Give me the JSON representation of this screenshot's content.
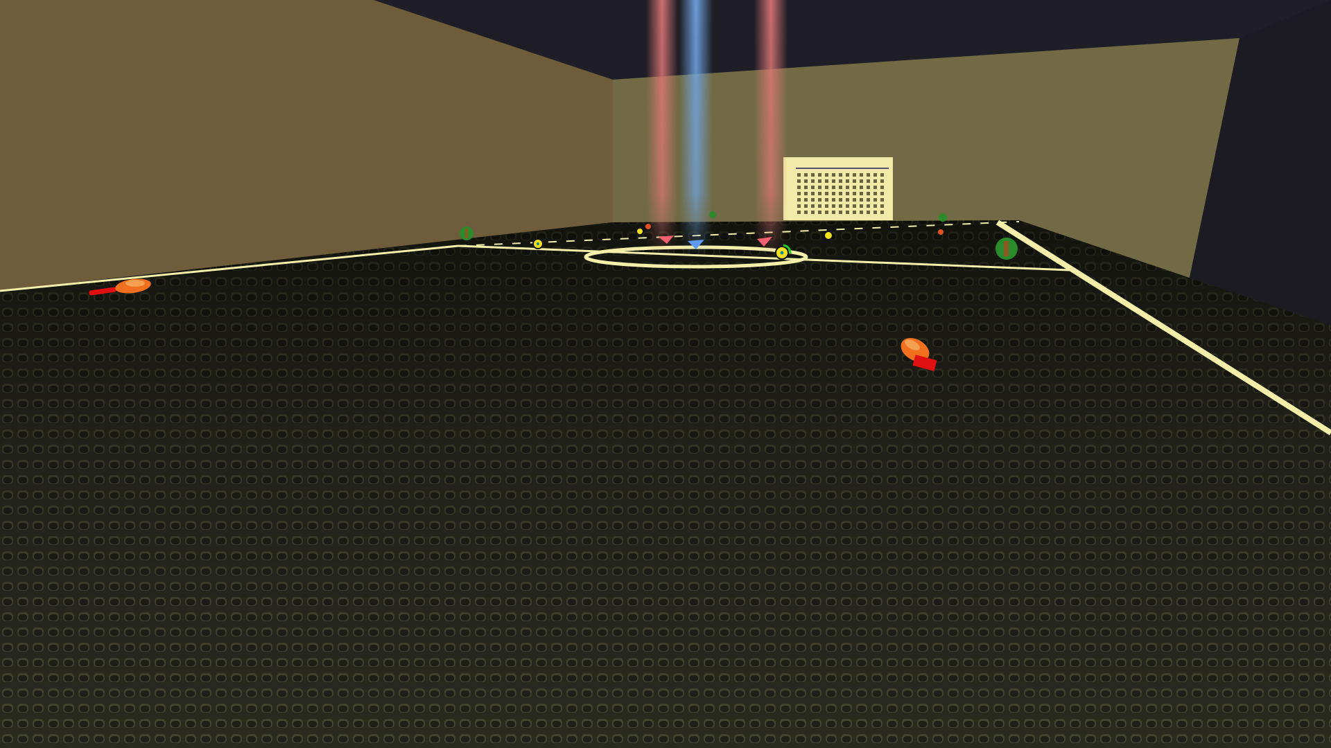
{
  "colors": {
    "ceiling": "#1f1e26",
    "left_wall": "#6e5c3b",
    "back_wall": "#6f6a43",
    "right_wall": "#1c1b22",
    "floor": "#2a2b1f",
    "floor_dimple": "#3f4030",
    "field_line": "#f3efaa",
    "beam_red": "#e07878",
    "beam_blue": "#6fa4e0",
    "goal": "#f2eaa8"
  }
}
